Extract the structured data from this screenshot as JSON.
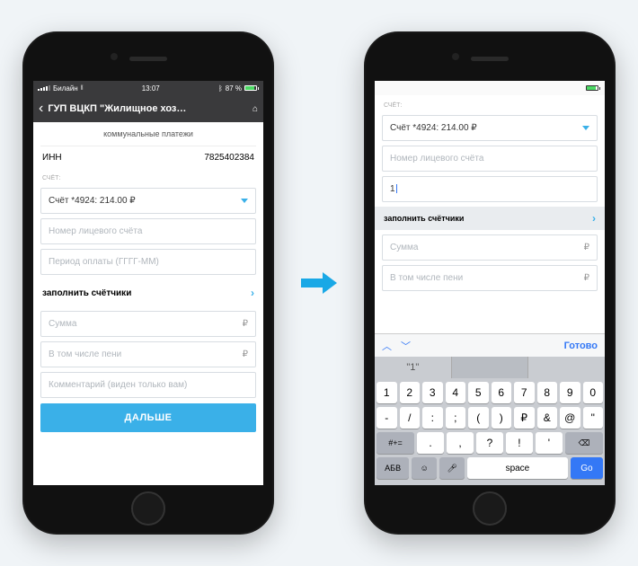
{
  "status": {
    "carrier": "Билайн",
    "time": "13:07",
    "battery_pct": "87 %"
  },
  "nav": {
    "title": "ГУП ВЦКП \"Жилищное хоз…"
  },
  "left": {
    "section": "коммунальные платежи",
    "inn_label": "ИНН",
    "inn_value": "7825402384",
    "account_label": "СЧЁТ:",
    "account_value": "Счёт *4924: 214.00 ₽",
    "input_personal": "Номер лицевого счёта",
    "input_period": "Период оплаты (ГГГГ-MM)",
    "meters_link": "заполнить счётчики",
    "input_amount": "Сумма",
    "input_fine": "В том числе пени",
    "input_comment": "Комментарий (виден только вам)",
    "currency": "₽",
    "next_btn": "ДАЛЬШЕ"
  },
  "right": {
    "account_label": "СЧЁТ:",
    "account_value": "Счёт *4924: 214.00 ₽",
    "input_personal_ph": "Номер лицевого счёта",
    "input_period_value": "1",
    "meters_link": "заполнить счётчики",
    "input_amount": "Сумма",
    "input_fine": "В том числе пени",
    "currency": "₽"
  },
  "keyboard": {
    "done": "Готово",
    "suggestion": "\"1\"",
    "row1": [
      "1",
      "2",
      "3",
      "4",
      "5",
      "6",
      "7",
      "8",
      "9",
      "0"
    ],
    "row2": [
      "-",
      "/",
      ":",
      ";",
      "(",
      ")",
      "₽",
      "&",
      "@",
      "\""
    ],
    "row3_sym": "#+=",
    "row3": [
      ".",
      ",",
      "?",
      "!",
      "'"
    ],
    "abc": "АБВ",
    "space": "space",
    "go": "Go"
  }
}
